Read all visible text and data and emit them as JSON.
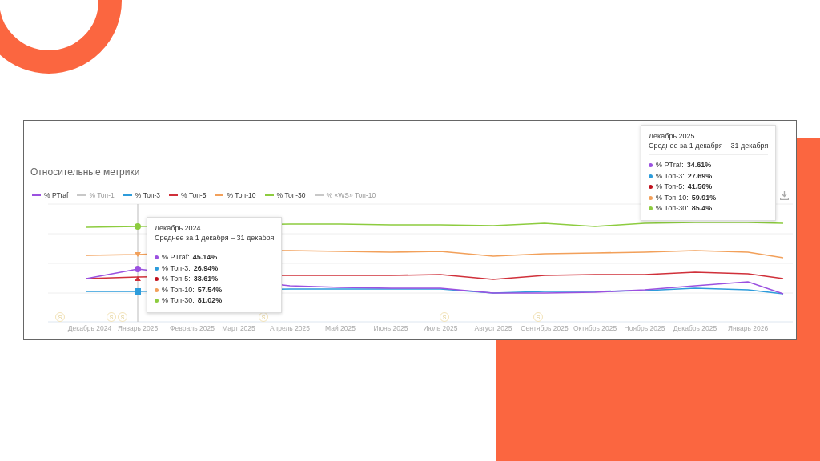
{
  "panel": {
    "title": "Относительные метрики",
    "legend": [
      {
        "label": "% PTraf",
        "color": "#9b51e0",
        "hidden": false
      },
      {
        "label": "% Топ-1",
        "color": "#c8c8c8",
        "hidden": true
      },
      {
        "label": "% Топ-3",
        "color": "#2d9cdb",
        "hidden": false
      },
      {
        "label": "% Топ-5",
        "color": "#d0303a",
        "hidden": false
      },
      {
        "label": "% Топ-10",
        "color": "#f2a05a",
        "hidden": false
      },
      {
        "label": "% Топ-30",
        "color": "#8dcc3f",
        "hidden": false
      },
      {
        "label": "% «WS» Топ-10",
        "color": "#c8c8c8",
        "hidden": true
      }
    ],
    "markers": [
      "S",
      "S",
      "S",
      "S",
      "S",
      "S"
    ],
    "x_axis_labels": [
      "Декабрь 2024",
      "Январь 2025",
      "Февраль 2025",
      "Март 2025",
      "Апрель 2025",
      "Май 2025",
      "Июнь 2025",
      "Июль 2025",
      "Август 2025",
      "Сентябрь 2025",
      "Октябрь 2025",
      "Ноябрь 2025",
      "Декабрь 2025",
      "Январь 2026"
    ],
    "tooltips": [
      {
        "title": "Декабрь 2024",
        "subtitle": "Среднее за 1 декабря – 31 декабря",
        "rows": [
          {
            "label": "% PTraf:",
            "value": "45.14%",
            "color": "#9b51e0"
          },
          {
            "label": "% Топ-3:",
            "value": "26.94%",
            "color": "#2d9cdb"
          },
          {
            "label": "% Топ-5:",
            "value": "38.61%",
            "color": "#c0101c"
          },
          {
            "label": "% Топ-10:",
            "value": "57.54%",
            "color": "#f2a05a"
          },
          {
            "label": "% Топ-30:",
            "value": "81.02%",
            "color": "#8dcc3f"
          }
        ]
      },
      {
        "title": "Декабрь 2025",
        "subtitle": "Среднее за 1 декабря – 31 декабря",
        "rows": [
          {
            "label": "% PTraf:",
            "value": "34.61%",
            "color": "#9b51e0"
          },
          {
            "label": "% Топ-3:",
            "value": "27.69%",
            "color": "#2d9cdb"
          },
          {
            "label": "% Топ-5:",
            "value": "41.56%",
            "color": "#c0101c"
          },
          {
            "label": "% Топ-10:",
            "value": "59.91%",
            "color": "#f2a05a"
          },
          {
            "label": "% Топ-30:",
            "value": "85.4%",
            "color": "#8dcc3f"
          }
        ]
      }
    ]
  }
}
